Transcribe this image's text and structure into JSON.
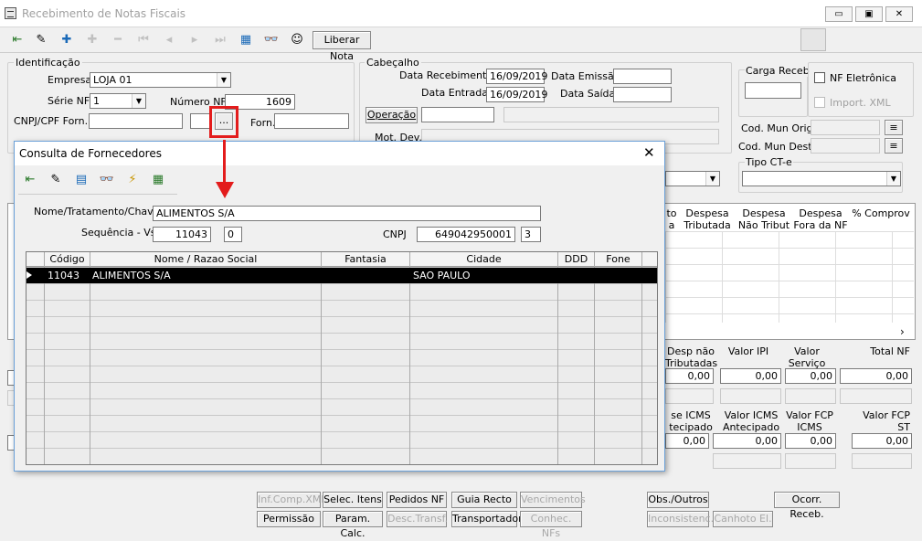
{
  "window": {
    "title": "Recebimento de Notas Fiscais"
  },
  "toolbar": {
    "liberar_label": "Liberar Nota"
  },
  "identificacao": {
    "label": "Identificação",
    "empresa_label": "Empresa",
    "empresa_value": "LOJA 01",
    "serie_label": "Série NF",
    "serie_value": "1",
    "numero_label": "Número NF",
    "numero_value": "1609",
    "cnpj_label": "CNPJ/CPF Forn.",
    "forn_label": "Forn.",
    "lookup_label": "..."
  },
  "cabecalho": {
    "label": "Cabeçalho",
    "data_receb_label": "Data Recebimento",
    "data_receb_value": "16/09/2019",
    "data_emissao_label": "Data Emissão",
    "data_entrada_label": "Data Entrada",
    "data_entrada_value": "16/09/2019",
    "data_saida_label": "Data Saída",
    "operacao_label": "Operação",
    "mot_dev_label": "Mot. Dev.",
    "carga_receb_label": "Carga Receb",
    "nf_eletronica_label": "NF Eletrônica",
    "import_xml_label": "Import. XML",
    "cod_mun_orig_label": "Cod. Mun Orig.",
    "cod_mun_dest_label": "Cod. Mun Dest.",
    "tipo_cte_label": "Tipo CT-e"
  },
  "grid_headers": [
    "Despesa Tributada",
    "Despesa Não Tribut",
    "Despesa Fora da NF",
    "% Comprov"
  ],
  "totals1": [
    {
      "label": "Desp não Tributadas",
      "value": "0,00"
    },
    {
      "label": "Valor IPI",
      "value": "0,00"
    },
    {
      "label": "Valor Serviço",
      "value": "0,00"
    },
    {
      "label": "Total NF",
      "value": "0,00"
    }
  ],
  "totals2": [
    {
      "label": "se ICMS tecipado",
      "value": "0,00"
    },
    {
      "label": "Valor ICMS Antecipado",
      "value": "0,00"
    },
    {
      "label": "Valor FCP ICMS",
      "value": "0,00"
    },
    {
      "label": "Valor FCP ST",
      "value": "0,00"
    }
  ],
  "bottom_buttons": [
    "Inf.Comp.XML",
    "Selec. Itens",
    "Pedidos NF",
    "Guia Recto",
    "Vencimentos",
    "Permissão",
    "Param. Calc.",
    "Desc.Transf.",
    "Transportador",
    "Conhec. NFs",
    "Obs./Outros",
    "Ocorr. Receb.",
    "Inconsistenc.",
    "Canhoto El."
  ],
  "modal": {
    "title": "Consulta de Fornecedores",
    "nome_label": "Nome/Tratamento/Chave",
    "nome_value": "ALIMENTOS S/A",
    "seq_label": "Sequência - Vs",
    "seq_value": "11043",
    "seq_vs": "0",
    "cnpj_label": "CNPJ",
    "cnpj_value": "649042950001",
    "cnpj_dv": "3",
    "columns": [
      "Código",
      "Nome / Razao Social",
      "Fantasia",
      "Cidade",
      "DDD",
      "Fone"
    ],
    "row": {
      "codigo": "11043",
      "nome": "ALIMENTOS S/A",
      "fantasia": "",
      "cidade": "SAO PAULO",
      "ddd": "",
      "fone": ""
    }
  },
  "colors": {
    "accent_red": "#e31c1c",
    "selection": "#000000"
  }
}
